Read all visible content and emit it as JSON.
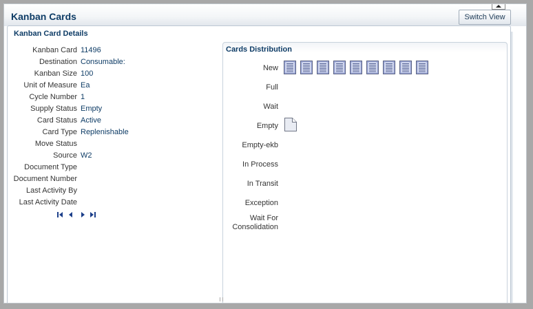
{
  "page": {
    "title": "Kanban Cards",
    "switch_view_label": "Switch View"
  },
  "details": {
    "title": "Kanban Card Details",
    "fields": [
      {
        "label": "Kanban Card",
        "value": "11496"
      },
      {
        "label": "Destination",
        "value": "Consumable:"
      },
      {
        "label": "Kanban Size",
        "value": "100"
      },
      {
        "label": "Unit of Measure",
        "value": "Ea"
      },
      {
        "label": "Cycle Number",
        "value": "1"
      },
      {
        "label": "Supply Status",
        "value": "Empty"
      },
      {
        "label": "Card Status",
        "value": "Active"
      },
      {
        "label": "Card Type",
        "value": "Replenishable"
      },
      {
        "label": "Move Status",
        "value": ""
      },
      {
        "label": "Source",
        "value": "W2"
      },
      {
        "label": "Document Type",
        "value": ""
      },
      {
        "label": "Document Number",
        "value": ""
      },
      {
        "label": "Last Activity By",
        "value": ""
      },
      {
        "label": "Last Activity Date",
        "value": ""
      }
    ],
    "nav_icons": [
      "first-record-icon",
      "previous-record-icon",
      "next-record-icon",
      "last-record-icon"
    ]
  },
  "distribution": {
    "title": "Cards Distribution",
    "statuses": [
      {
        "label": "New",
        "card_count": 9
      },
      {
        "label": "Full",
        "card_count": 0
      },
      {
        "label": "Wait",
        "card_count": 0
      },
      {
        "label": "Empty",
        "card_count": 1
      },
      {
        "label": "Empty-ekb",
        "card_count": 0
      },
      {
        "label": "In Process",
        "card_count": 0
      },
      {
        "label": "In Transit",
        "card_count": 0
      },
      {
        "label": "Exception",
        "card_count": 0
      },
      {
        "label": "Wait For",
        "label_line2": "Consolidation",
        "card_count": 0
      }
    ],
    "new_card_icon": "kanban-card-list-icon",
    "empty_card_icon": "blank-document-icon"
  },
  "colors": {
    "title_text": "#0e3c66",
    "card_icon_fill": "#9ca8d8",
    "background": "#a8a8a8"
  }
}
